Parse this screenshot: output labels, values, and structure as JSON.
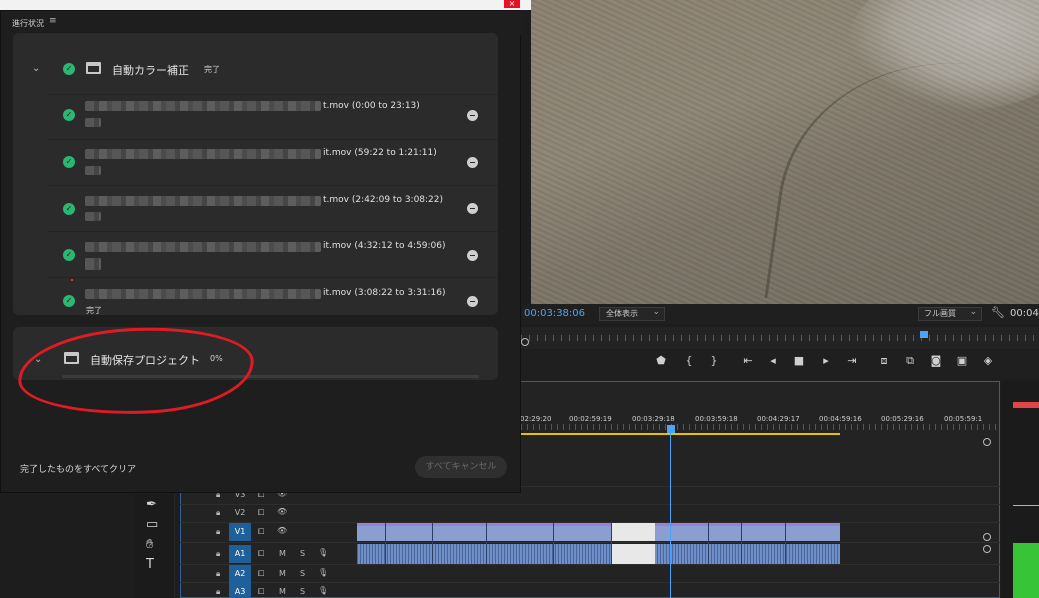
{
  "window": {
    "close_glyph": "×"
  },
  "progress_panel": {
    "title": "進行状況",
    "menu_icon": "≡",
    "groups": [
      {
        "name": "自動カラー補正",
        "status": "完了",
        "items": [
          {
            "filename_suffix": "t.mov (0:00 to 23:13)",
            "status": ""
          },
          {
            "filename_suffix": "it.mov (59:22 to 1:21:11)",
            "status": ""
          },
          {
            "filename_suffix": "t.mov (2:42:09 to 3:08:22)",
            "status": ""
          },
          {
            "filename_suffix": "it.mov (4:32:12 to 4:59:06)",
            "status": ""
          },
          {
            "filename_suffix": "it.mov (3:08:22 to 3:31:16)",
            "status": "完了"
          }
        ]
      },
      {
        "name": "自動保存プロジェクト",
        "status": "0%",
        "progress": 0
      }
    ],
    "footer": {
      "clear_label": "完了したものをすべてクリア",
      "cancel_label": "すべてキャンセル"
    }
  },
  "monitor": {
    "timecode": "00:03:38:06",
    "fit_label": "全体表示",
    "resolution_label": "フル画質",
    "right_timecode": "00:04"
  },
  "timeline": {
    "ruler_labels": [
      "02:29:20",
      "00:02:59:19",
      "00:03:29:18",
      "00:03:59:18",
      "00:04:29:17",
      "00:04:59:16",
      "00:05:29:16",
      "00:05:59:1"
    ],
    "tracks": [
      {
        "name": "V3",
        "type": "video",
        "active": false
      },
      {
        "name": "V2",
        "type": "video",
        "active": false
      },
      {
        "name": "V1",
        "type": "video",
        "active": true
      },
      {
        "name": "A1",
        "type": "audio",
        "active": true
      },
      {
        "name": "A2",
        "type": "audio",
        "active": true
      },
      {
        "name": "A3",
        "type": "audio",
        "active": true
      }
    ],
    "audio_toggle_m": "M",
    "audio_toggle_s": "S"
  },
  "colors": {
    "accent": "#4aa3ff",
    "check": "#2bb673",
    "annotation": "#e01b24",
    "inout": "#e6c100"
  }
}
